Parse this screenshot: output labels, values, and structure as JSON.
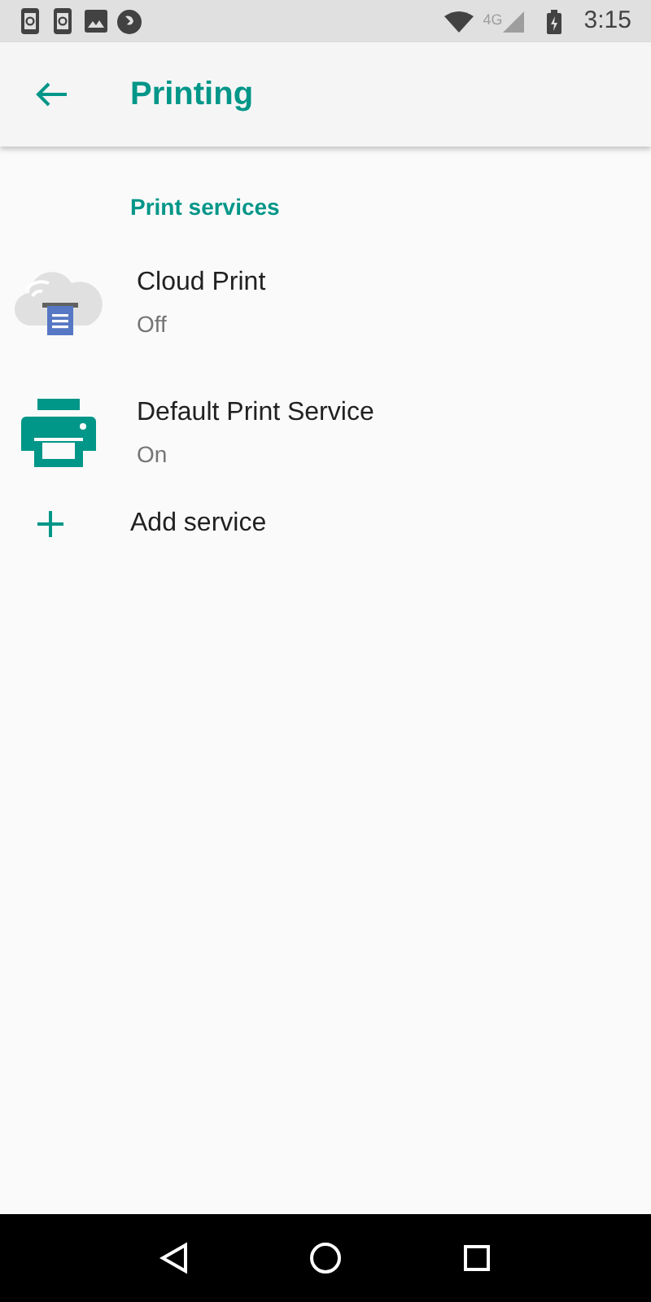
{
  "status_bar": {
    "network": "4G",
    "time": "3:15"
  },
  "app_bar": {
    "title": "Printing"
  },
  "section": {
    "title": "Print services"
  },
  "services": [
    {
      "kind": "cloud",
      "name": "Cloud Print",
      "status": "Off"
    },
    {
      "kind": "printer",
      "name": "Default Print Service",
      "status": "On"
    }
  ],
  "add": {
    "label": "Add service"
  }
}
